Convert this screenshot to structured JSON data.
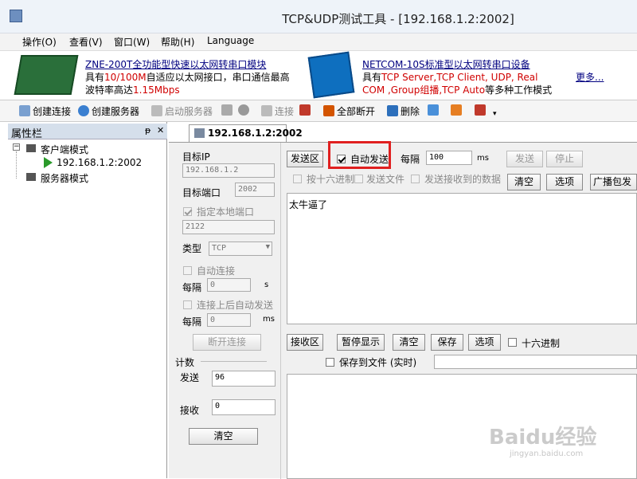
{
  "window": {
    "title": "TCP&UDP测试工具 - [192.168.1.2:2002]"
  },
  "menu": [
    "操作(O)",
    "查看(V)",
    "窗口(W)",
    "帮助(H)",
    "Language"
  ],
  "banner": {
    "left_title": "ZNE-200T全功能型快速以太网转串口模块",
    "left_line1_a": "具有",
    "left_line1_b": "10/100M",
    "left_line1_c": "自适应以太网接口，串口通信最高",
    "left_line2_a": "波特率高达",
    "left_line2_b": "1.15Mbps",
    "right_title": "NETCOM-10S标准型以太网转串口设备",
    "right_line1_a": "具有",
    "right_line1_b": "TCP Server,TCP Client, UDP, Real",
    "right_line2_a": "COM ,Group组播,TCP Auto",
    "right_line2_b": "等多种工作模式",
    "more": "更多..."
  },
  "toolbar": {
    "create_conn": "创建连接",
    "create_server": "创建服务器",
    "start_server": "启动服务器",
    "connect": "连接",
    "disconnect_all": "全部断开",
    "delete": "删除"
  },
  "sidebar": {
    "title": "属性栏",
    "pin": "ᵽ",
    "close": "✕",
    "client_mode": "客户端模式",
    "client_item": "192.168.1.2:2002",
    "server_mode": "服务器模式"
  },
  "tab": {
    "label": "192.168.1.2:2002"
  },
  "left": {
    "target_ip_label": "目标IP",
    "target_ip": "192.168.1.2",
    "target_port_label": "目标端口",
    "target_port": "2002",
    "local_port_label": "指定本地端口",
    "local_port": "2122",
    "type_label": "类型",
    "type_value": "TCP",
    "auto_connect": "自动连接",
    "interval_label": "每隔",
    "interval_value": "0",
    "interval_unit": "s",
    "auto_send_after": "连接上后自动发送",
    "interval2_label": "每隔",
    "interval2_value": "0",
    "interval2_unit": "ms",
    "disconnect_btn": "断开连接",
    "count_label": "计数",
    "send_label": "发送",
    "send_value": "96",
    "recv_label": "接收",
    "recv_value": "0",
    "clear_btn": "清空"
  },
  "send": {
    "area_label": "发送区",
    "auto_send": "自动发送",
    "every_label": "每隔",
    "every_value": "100",
    "every_unit": "ms",
    "send_btn": "发送",
    "stop_btn": "停止",
    "hex": "按十六进制",
    "send_file": "发送文件",
    "send_received": "发送接收到的数据",
    "clear_btn": "清空",
    "options_btn": "选项",
    "broadcast_btn": "广播包发送",
    "content": "太牛逼了"
  },
  "recv": {
    "area_label": "接收区",
    "pause_btn": "暂停显示",
    "clear_btn": "清空",
    "save_btn": "保存",
    "options_btn": "选项",
    "hex": "十六进制",
    "save_to_file": "保存到文件 (实时)"
  },
  "watermark": {
    "text": "Baidu经验",
    "url": "jingyan.baidu.com"
  },
  "colors": {
    "accent": "#e02020",
    "link": "#000080",
    "highlight_red": "#d00000"
  }
}
